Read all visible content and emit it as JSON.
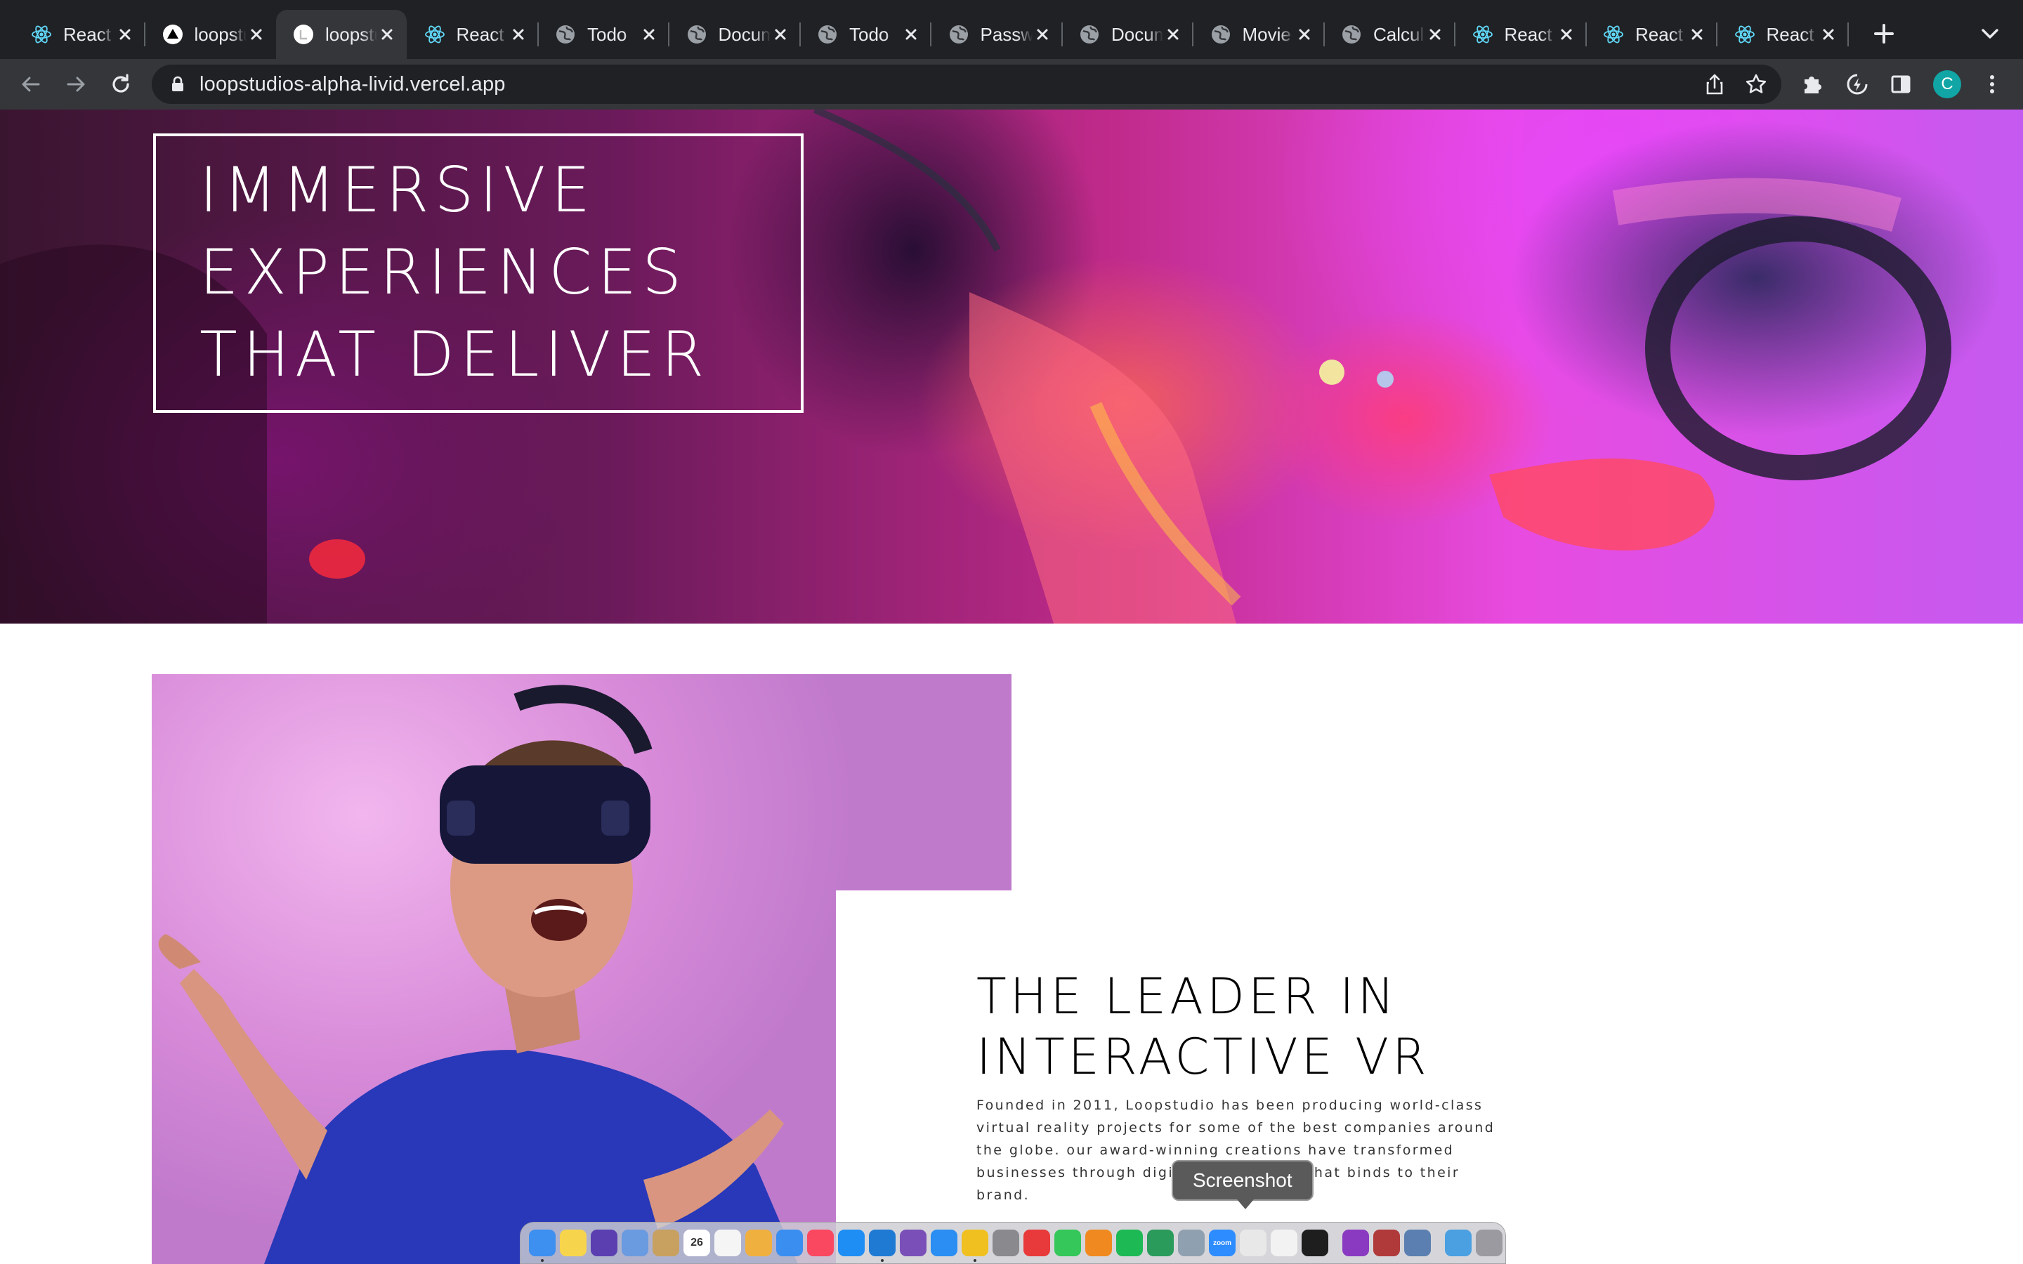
{
  "browser": {
    "tabs": [
      {
        "title": "React App",
        "icon": "react-icon",
        "active": false
      },
      {
        "title": "loopstudios",
        "icon": "vercel-icon",
        "active": false
      },
      {
        "title": "loopstudios",
        "icon": "loopstudios-icon",
        "active": true
      },
      {
        "title": "React App",
        "icon": "react-icon",
        "active": false
      },
      {
        "title": "Todo",
        "icon": "globe-icon",
        "active": false
      },
      {
        "title": "Document",
        "icon": "globe-icon",
        "active": false
      },
      {
        "title": "Todo",
        "icon": "globe-icon",
        "active": false
      },
      {
        "title": "Password",
        "icon": "globe-icon",
        "active": false
      },
      {
        "title": "Document",
        "icon": "globe-icon",
        "active": false
      },
      {
        "title": "Movie",
        "icon": "globe-icon",
        "active": false
      },
      {
        "title": "Calculator",
        "icon": "globe-icon",
        "active": false
      },
      {
        "title": "React App",
        "icon": "react-icon",
        "active": false
      },
      {
        "title": "React App",
        "icon": "react-icon",
        "active": false
      },
      {
        "title": "React App",
        "icon": "react-icon",
        "active": false
      }
    ],
    "url": "loopstudios-alpha-livid.vercel.app",
    "profile_initial": "C",
    "colors": {
      "tabbar": "#202124",
      "toolbar": "#35363a",
      "avatar": "#11a5a5"
    }
  },
  "hero": {
    "lines": [
      "IMMERSIVE",
      "EXPERIENCES",
      "THAT DELIVER"
    ]
  },
  "leader": {
    "title_line1": "THE LEADER IN",
    "title_line2": "INTERACTIVE VR",
    "body": "Founded in 2011, Loopstudio has been producing world-class virtual reality projects for some of the best companies around the globe. our award-winning creations have transformed businesses through digital experiences that binds to their brand."
  },
  "tooltip": {
    "label": "Screenshot"
  },
  "dock": {
    "apps": [
      {
        "name": "finder-icon",
        "color": "#3d8ff0",
        "running": true
      },
      {
        "name": "notes-icon",
        "color": "#f6d54c",
        "running": false
      },
      {
        "name": "siri-icon",
        "color": "#5b3fb0",
        "running": false
      },
      {
        "name": "preview-icon",
        "color": "#6a9be0",
        "running": false
      },
      {
        "name": "notebook-icon",
        "color": "#c8a060",
        "running": false
      },
      {
        "name": "calendar-icon",
        "color": "#ffffff",
        "running": false,
        "text": "26"
      },
      {
        "name": "reminders-icon",
        "color": "#f5f5f5",
        "running": false
      },
      {
        "name": "photos-icon",
        "color": "#f0b040",
        "running": false
      },
      {
        "name": "messages-bubble-icon",
        "color": "#3a8ef0",
        "running": false
      },
      {
        "name": "music-icon",
        "color": "#fa4860",
        "running": false
      },
      {
        "name": "app-store-icon",
        "color": "#1e8ef5",
        "running": false
      },
      {
        "name": "vscode-icon",
        "color": "#1f7ad4",
        "running": true
      },
      {
        "name": "github-desktop-icon",
        "color": "#7a4fb8",
        "running": false
      },
      {
        "name": "safari-icon",
        "color": "#2a8ef2",
        "running": false
      },
      {
        "name": "chrome-icon",
        "color": "#f0c020",
        "running": true
      },
      {
        "name": "settings-icon",
        "color": "#8a8a8e",
        "running": false
      },
      {
        "name": "wps-office-icon",
        "color": "#e83a3a",
        "running": false
      },
      {
        "name": "facetime-icon",
        "color": "#35c759",
        "running": false
      },
      {
        "name": "infuse-icon",
        "color": "#f08a20",
        "running": false
      },
      {
        "name": "spotify-icon",
        "color": "#1db954",
        "running": false
      },
      {
        "name": "google-meet-icon",
        "color": "#2a9b5a",
        "running": false
      },
      {
        "name": "testflight-icon",
        "color": "#8fa0b0",
        "running": false
      },
      {
        "name": "zoom-icon",
        "color": "#2d8cff",
        "running": false,
        "text": "zoom"
      },
      {
        "name": "screenshot-icon",
        "color": "#e8e8e8",
        "running": false
      },
      {
        "name": "textedit-icon",
        "color": "#f2f2f2",
        "running": false
      },
      {
        "name": "figma-icon",
        "color": "#1e1e1e",
        "running": false
      },
      {
        "name": "divider",
        "color": "",
        "running": false
      },
      {
        "name": "bluetooth-app-icon",
        "color": "#8a3ac0",
        "running": false
      },
      {
        "name": "dictionary-icon",
        "color": "#b03a3a",
        "running": false
      },
      {
        "name": "preview-doc-icon",
        "color": "#5a7fb0",
        "running": false
      },
      {
        "name": "divider",
        "color": "",
        "running": false
      },
      {
        "name": "downloads-folder-icon",
        "color": "#4aa0e0",
        "running": false
      },
      {
        "name": "trash-icon",
        "color": "#9a9aa0",
        "running": false
      }
    ]
  }
}
